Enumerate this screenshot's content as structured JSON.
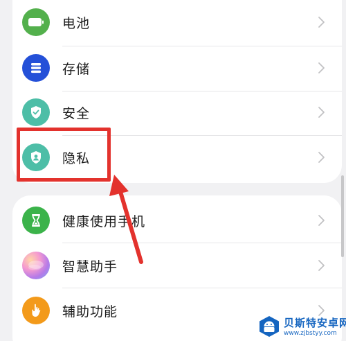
{
  "settings_group_1": {
    "items": [
      {
        "label": "电池",
        "icon": "battery-icon",
        "icon_color": "#53b04c"
      },
      {
        "label": "存储",
        "icon": "storage-icon",
        "icon_color": "#2450d8"
      },
      {
        "label": "安全",
        "icon": "security-shield-icon",
        "icon_color": "#4dbea7"
      },
      {
        "label": "隐私",
        "icon": "privacy-icon",
        "icon_color": "#4dbea7"
      }
    ]
  },
  "settings_group_2": {
    "items": [
      {
        "label": "健康使用手机",
        "icon": "hourglass-icon",
        "icon_color": "#3bb34a"
      },
      {
        "label": "智慧助手",
        "icon": "smart-assistant-icon",
        "icon_color": "#c86bd6"
      },
      {
        "label": "辅助功能",
        "icon": "accessibility-hand-icon",
        "icon_color": "#f39a1a"
      }
    ]
  },
  "annotation": {
    "color": "#e3322d",
    "highlighted_item": "隐私"
  },
  "watermark": {
    "title": "贝斯特安卓网",
    "url": "www.zjbstyy.com",
    "color": "#1565c0"
  }
}
